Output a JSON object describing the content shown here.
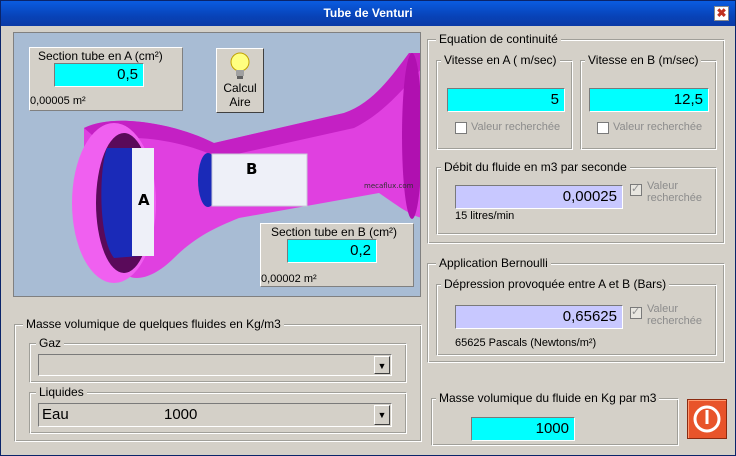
{
  "window": {
    "title": "Tube de Venturi",
    "close_glyph": "✖"
  },
  "illustration": {
    "label_a": "A",
    "label_b": "B",
    "watermark": "mecaflux.com",
    "section_a": {
      "title": "Section tube en A (cm²)",
      "value": "0,5",
      "sub": "0,00005 m²"
    },
    "section_b": {
      "title": "Section tube en B (cm²)",
      "value": "0,2",
      "sub": "0,00002 m²"
    },
    "calc_button": {
      "line1": "Calcul",
      "line2": "Aire",
      "icon": "lightbulb-icon"
    }
  },
  "continuity": {
    "title": "Equation de continuité",
    "speed_a": {
      "title": "Vitesse en A  ( m/sec)",
      "value": "5",
      "checkbox_label": "Valeur recherchée"
    },
    "speed_b": {
      "title": "Vitesse en B (m/sec)",
      "value": "12,5",
      "checkbox_label": "Valeur recherchée"
    },
    "flow": {
      "title": "Débit du fluide en m3 par seconde",
      "value": "0,00025",
      "sub": "15 litres/min",
      "checkbox_line1": "Valeur",
      "checkbox_line2": "recherchée"
    }
  },
  "bernoulli": {
    "title": "Application Bernoulli",
    "depression": {
      "title": "Dépression provoquée entre A et B (Bars)",
      "value": "0,65625",
      "sub": "65625 Pascals (Newtons/m²)",
      "checkbox_line1": "Valeur",
      "checkbox_line2": "recherchée"
    }
  },
  "fluids": {
    "title": "Masse volumique de quelques fluides en Kg/m3",
    "gas": {
      "title": "Gaz",
      "selected": ""
    },
    "liquids": {
      "title": "Liquides",
      "selected_name": "Eau",
      "selected_value": "1000"
    }
  },
  "density": {
    "title": "Masse volumique du fluide en Kg par m3",
    "value": "1000"
  },
  "colors": {
    "title_bar": "#0843b8",
    "field_cyan": "#00ffff",
    "field_lavender": "#c8c8ff",
    "tube": "#e040e0",
    "section": "#1a2ab8",
    "stop": "#e8542a"
  }
}
